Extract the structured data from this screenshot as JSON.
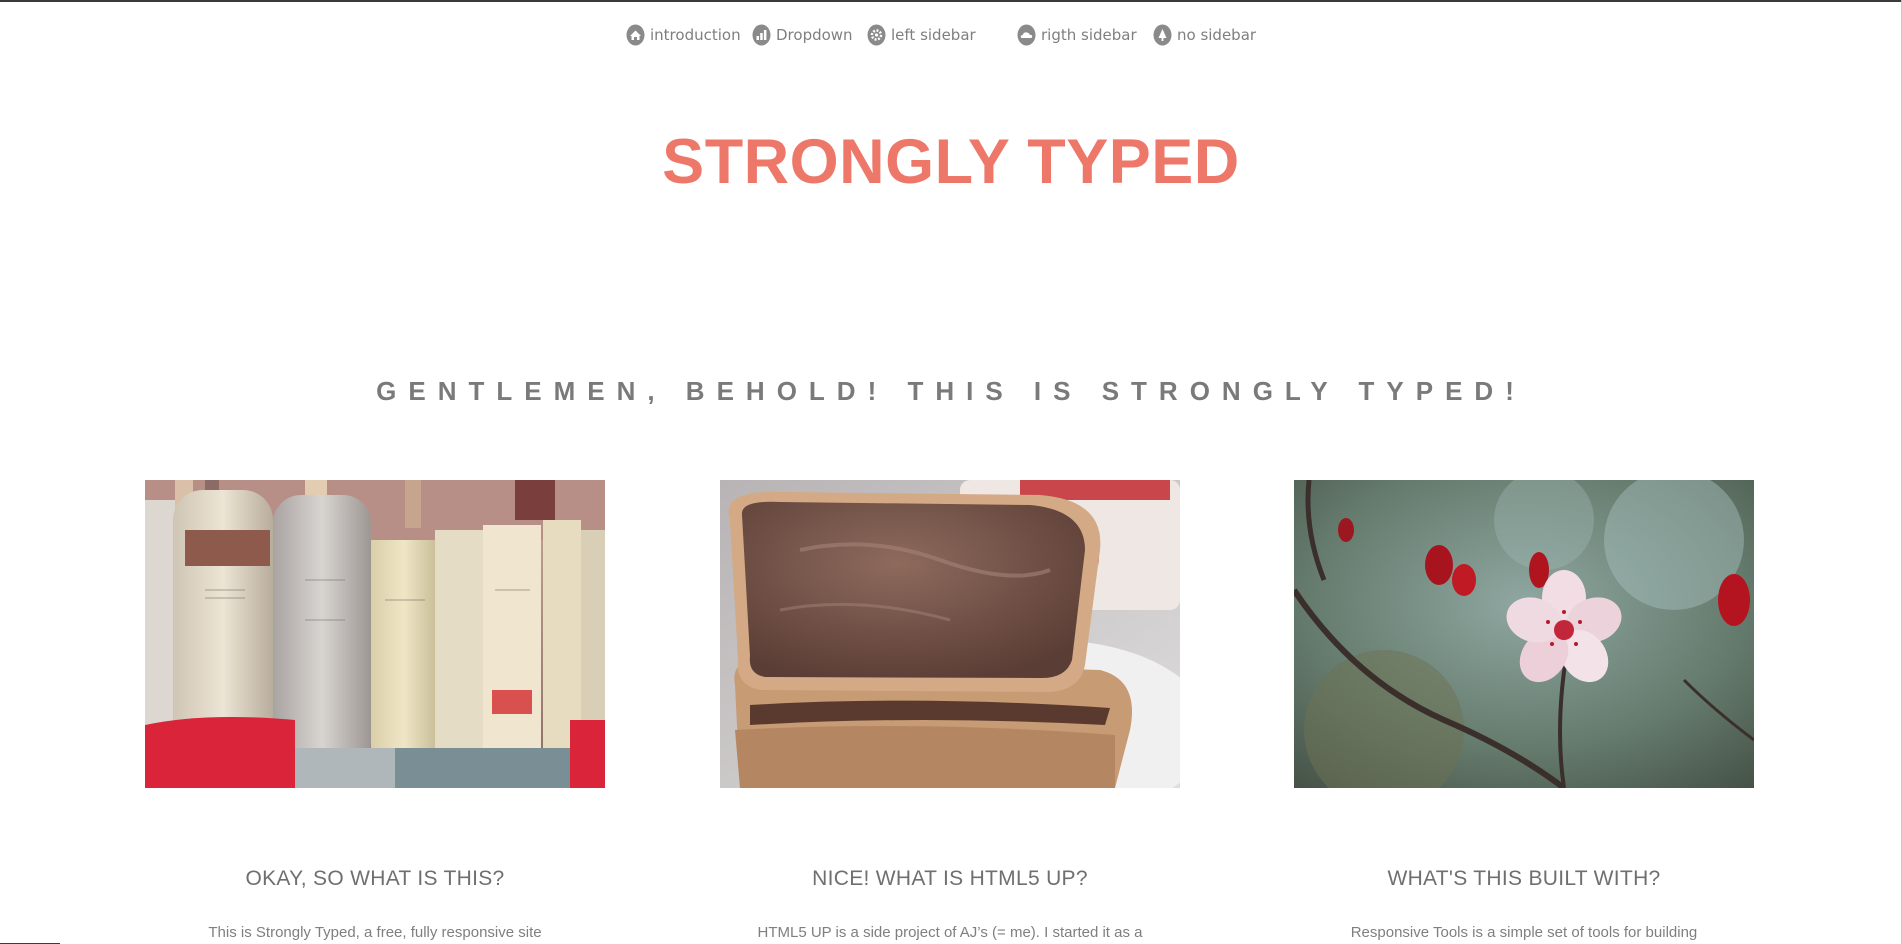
{
  "nav": {
    "items": [
      {
        "label": "introduction",
        "icon": "home-icon"
      },
      {
        "label": "Dropdown",
        "icon": "bar-chart-icon"
      },
      {
        "label": "left sidebar",
        "icon": "gear-icon"
      },
      {
        "label": "rigth sidebar",
        "icon": "cloud-icon"
      },
      {
        "label": "no sidebar",
        "icon": "tree-icon"
      }
    ]
  },
  "header": {
    "logo": "STRONGLY TYPED"
  },
  "banner": {
    "text": "GENTLEMEN, BEHOLD! THIS IS STRONGLY TYPED!"
  },
  "features": [
    {
      "image": "books photo",
      "title": "OKAY, SO WHAT IS THIS?",
      "text": "This is Strongly Typed, a free, fully responsive site"
    },
    {
      "image": "chocolate spread toast photo",
      "title": "NICE! WHAT IS HTML5 UP?",
      "text": "HTML5 UP is a side project of AJ’s (= me). I started it as a"
    },
    {
      "image": "cherry blossom photo",
      "title": "WHAT'S THIS BUILT WITH?",
      "text": "Responsive Tools is a simple set of tools for building"
    }
  ],
  "colors": {
    "accent": "#ed786a",
    "text": "#7f7f7f",
    "icon": "#8a8a8a"
  }
}
